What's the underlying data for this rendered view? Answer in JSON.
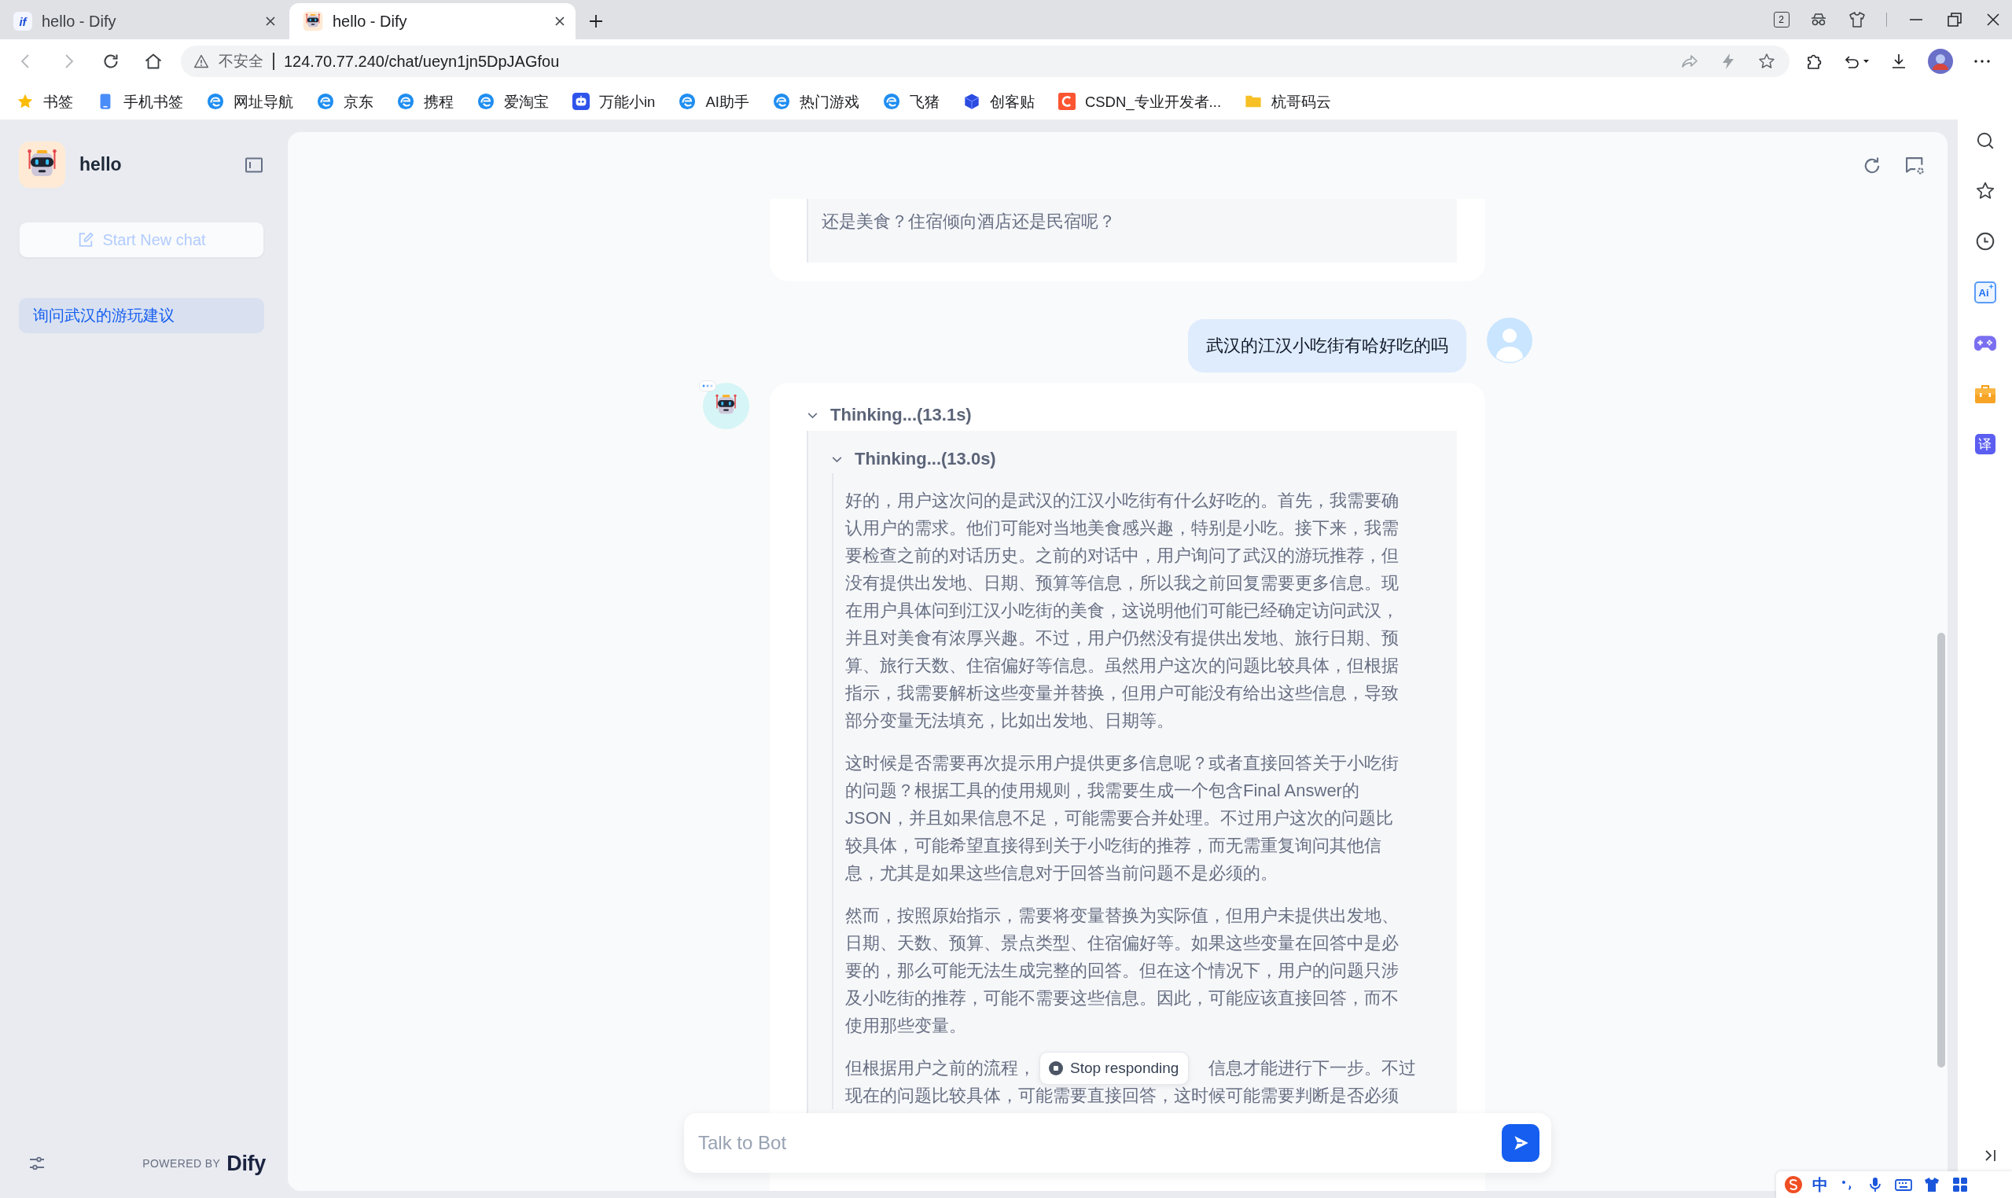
{
  "browser": {
    "tabs": [
      {
        "title": "hello - Dify",
        "favicon": {
          "kind": "letters",
          "text": "if"
        },
        "selected": false
      },
      {
        "title": "hello - Dify",
        "favicon": {
          "kind": "robot"
        },
        "selected": true
      }
    ],
    "tab_count": "2",
    "nav": {
      "back": {
        "disabled": true
      },
      "forward": {
        "disabled": true
      }
    },
    "address": {
      "security_label": "不安全",
      "url": "124.70.77.240/chat/ueyn1jn5DpJAGfou"
    },
    "bookmarks": [
      {
        "label": "书签",
        "kind": "star"
      },
      {
        "label": "手机书签",
        "kind": "phone"
      },
      {
        "label": "网址导航",
        "kind": "swirl"
      },
      {
        "label": "京东",
        "kind": "swirl"
      },
      {
        "label": "携程",
        "kind": "swirl"
      },
      {
        "label": "爱淘宝",
        "kind": "swirl"
      },
      {
        "label": "万能小in",
        "kind": "robot"
      },
      {
        "label": "AI助手",
        "kind": "swirl"
      },
      {
        "label": "热门游戏",
        "kind": "swirl"
      },
      {
        "label": "飞猪",
        "kind": "swirl"
      },
      {
        "label": "创客贴",
        "kind": "cube"
      },
      {
        "label": "CSDN_专业开发者...",
        "kind": "tile"
      },
      {
        "label": "杭哥码云",
        "kind": "folder"
      }
    ]
  },
  "sidebar": {
    "app_name": "hello",
    "new_chat": {
      "label": "Start New chat",
      "disabled": true
    },
    "conversations": [
      {
        "title": "询问武汉的游玩建议",
        "selected": true
      }
    ],
    "powered_by": "POWERED BY",
    "brand": "Dify"
  },
  "chat": {
    "messages": [
      {
        "kind": "bot",
        "avatar": false,
        "quote": "还是美食？住宿倾向酒店还是民宿呢？"
      },
      {
        "kind": "user",
        "text": "武汉的江汉小吃街有哈好吃的吗"
      },
      {
        "kind": "bot",
        "avatar": true,
        "loading": true,
        "thinking": {
          "title": "Thinking...(13.1s)",
          "expanded": true,
          "nested": {
            "title": "Thinking...(13.0s)",
            "expanded": true,
            "paragraphs": [
              "好的，用户这次问的是武汉的江汉小吃街有什么好吃的。首先，我需要确认用户的需求。他们可能对当地美食感兴趣，特别是小吃。接下来，我需要检查之前的对话历史。之前的对话中，用户询问了武汉的游玩推荐，但没有提供出发地、日期、预算等信息，所以我之前回复需要更多信息。现在用户具体问到江汉小吃街的美食，这说明他们可能已经确定访问武汉，并且对美食有浓厚兴趣。不过，用户仍然没有提供出发地、旅行日期、预算、旅行天数、住宿偏好等信息。虽然用户这次的问题比较具体，但根据指示，我需要解析这些变量并替换，但用户可能没有给出这些信息，导致部分变量无法填充，比如出发地、日期等。",
              "这时候是否需要再次提示用户提供更多信息呢？或者直接回答关于小吃街的问题？根据工具的使用规则，我需要生成一个包含Final Answer的JSON，并且如果信息不足，可能需要合并处理。不过用户这次的问题比较具体，可能希望直接得到关于小吃街的推荐，而无需重复询问其他信息，尤其是如果这些信息对于回答当前问题不是必须的。",
              "然而，按照原始指示，需要将变量替换为实际值，但用户未提供出发地、日期、天数、预算、景点类型、住宿偏好等。如果这些变量在回答中是必要的，那么可能无法生成完整的回答。但在这个情况下，用户的问题只涉及小吃街的推荐，可能不需要这些信息。因此，可能应该直接回答，而不使用那些变量。"
            ],
            "covered_line": {
              "before": "但根据用户之前的流程，",
              "after": "信息才能进行下一步。不过"
            },
            "last_line": "现在的问题比较具体，可能需要直接回答，这时候可能需要判断是否必须"
          }
        }
      }
    ],
    "stop_label": "Stop responding",
    "input": {
      "placeholder": "Talk to Bot"
    }
  },
  "browser_sidebar": {
    "tools": [
      {
        "kind": "search"
      },
      {
        "kind": "star"
      },
      {
        "kind": "history"
      },
      {
        "kind": "ai",
        "text": "Ai"
      },
      {
        "kind": "game"
      },
      {
        "kind": "toolbox"
      },
      {
        "kind": "translate",
        "text": "译"
      }
    ]
  },
  "ime_toolbar": {
    "mode": "中"
  }
}
